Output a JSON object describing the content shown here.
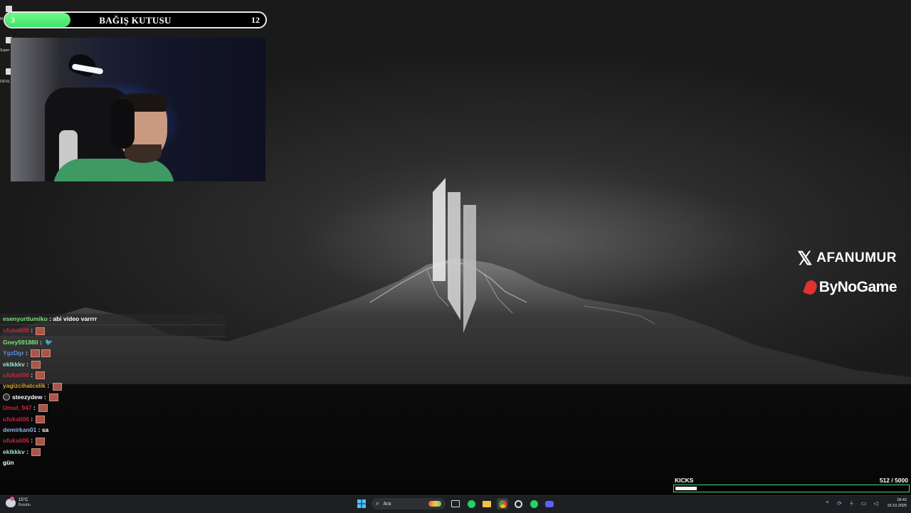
{
  "desktop_icons": [
    {
      "label": "M",
      "icon": "app-icon"
    },
    {
      "label": "Super",
      "icon": "app-icon"
    },
    {
      "label": "DEVIL",
      "icon": "app-icon"
    }
  ],
  "donation": {
    "title": "BAĞIŞ KUTUSU",
    "current": "3",
    "goal": "12",
    "progress_fraction": 0.25,
    "fill_color": "#3fe26a"
  },
  "branding": {
    "x_handle": "AFANUMUR",
    "x_icon": "x-logo-icon",
    "sponsor": "ByNoGame",
    "sponsor_icon": "bynogame-logo-icon",
    "sponsor_color": "#e2322f"
  },
  "chat": {
    "messages": [
      {
        "user": "esenyurtlumiko",
        "color": "#7ee07b",
        "message": "abi video varrrr",
        "emotes": 0,
        "banded": true
      },
      {
        "user": "ufukali06",
        "color": "#d2203a",
        "message": "",
        "emotes": 1,
        "banded": true
      },
      {
        "user": "Gney591880",
        "color": "#7ee07b",
        "message": "",
        "emotes": 0,
        "bird": true,
        "banded": false
      },
      {
        "user": "YgzDgr",
        "color": "#5a8ee6",
        "message": "",
        "emotes": 2,
        "banded": false
      },
      {
        "user": "eklkkkv",
        "color": "#9fe0d2",
        "message": "",
        "emotes": 1,
        "banded": false
      },
      {
        "user": "ufukali06",
        "color": "#d2203a",
        "message": "",
        "emotes": 1,
        "banded": false
      },
      {
        "user": "yagizcihatcelik",
        "color": "#e0a72e",
        "message": "",
        "emotes": 1,
        "banded": false
      },
      {
        "user": "steezydew",
        "color": "#ffffff",
        "message": "",
        "emotes": 1,
        "badge": true,
        "banded": false
      },
      {
        "user": "Umut_947",
        "color": "#d2203a",
        "message": "",
        "emotes": 1,
        "banded": false
      },
      {
        "user": "ufukali06",
        "color": "#d2203a",
        "message": "",
        "emotes": 1,
        "banded": false
      },
      {
        "user": "demirkan01",
        "color": "#8fb3ea",
        "message": "sa",
        "emotes": 0,
        "banded": false
      },
      {
        "user": "ufukali06",
        "color": "#d2203a",
        "message": "",
        "emotes": 1,
        "banded": false
      },
      {
        "user": "eklkkkv",
        "color": "#9fe0d2",
        "message": "",
        "emotes": 1,
        "banded": false
      },
      {
        "user": "gün",
        "color": "#ffffff",
        "message": "",
        "emotes": 0,
        "no_separator": true,
        "banded": false
      }
    ]
  },
  "kicks": {
    "label": "KICKS",
    "value_text": "512  / 5000",
    "progress_fraction": 0.1024,
    "border_color": "#49d86a"
  },
  "taskbar": {
    "weather_temp": "15°C",
    "weather_desc": "Bulutlu",
    "search_placeholder": "Ara",
    "apps": [
      "windows-start-icon",
      "search-icon",
      "task-view-icon",
      "spotify-icon",
      "file-explorer-icon",
      "chrome-icon",
      "chrome-alt-icon",
      "whatsapp-icon",
      "discord-icon"
    ],
    "time": "18:42",
    "date": "19.10.2025"
  }
}
